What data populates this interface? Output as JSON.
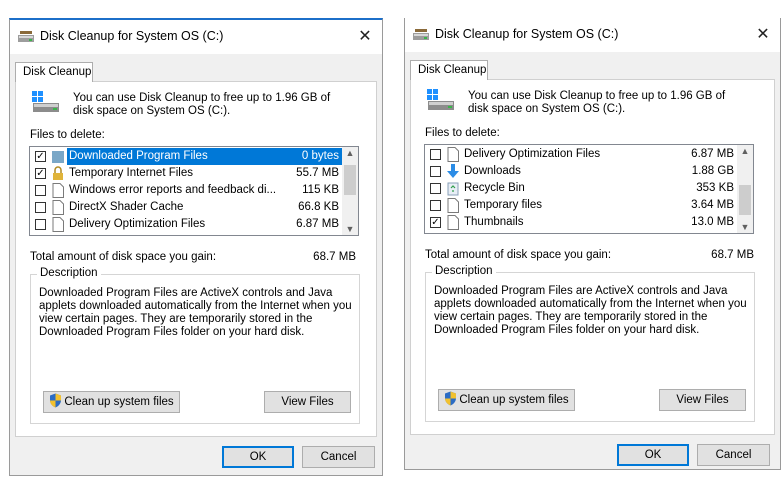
{
  "left": {
    "title": "Disk Cleanup for System OS (C:)",
    "tab": "Disk Cleanup",
    "intro": "You can use Disk Cleanup to free up to 1.96 GB of disk space on System OS (C:).",
    "files_label": "Files to delete:",
    "files": [
      {
        "checked": true,
        "name": "Downloaded Program Files",
        "size": "0 bytes",
        "selected": true,
        "icon": "folder-icon"
      },
      {
        "checked": true,
        "name": "Temporary Internet Files",
        "size": "55.7 MB",
        "selected": false,
        "icon": "lock-icon"
      },
      {
        "checked": false,
        "name": "Windows error reports and feedback di...",
        "size": "115 KB",
        "selected": false,
        "icon": "file-icon"
      },
      {
        "checked": false,
        "name": "DirectX Shader Cache",
        "size": "66.8 KB",
        "selected": false,
        "icon": "file-icon"
      },
      {
        "checked": false,
        "name": "Delivery Optimization Files",
        "size": "6.87 MB",
        "selected": false,
        "icon": "file-icon"
      }
    ],
    "total_label": "Total amount of disk space you gain:",
    "total_value": "68.7 MB",
    "description_legend": "Description",
    "description": "Downloaded Program Files are ActiveX controls and Java applets downloaded automatically from the Internet when you view certain pages. They are temporarily stored in the Downloaded Program Files folder on your hard disk.",
    "cleanup_button": "Clean up system files",
    "view_button": "View Files",
    "ok": "OK",
    "cancel": "Cancel"
  },
  "right": {
    "title": "Disk Cleanup for System OS (C:)",
    "tab": "Disk Cleanup",
    "intro": "You can use Disk Cleanup to free up to 1.96 GB of disk space on System OS (C:).",
    "files_label": "Files to delete:",
    "files": [
      {
        "checked": false,
        "name": "Delivery Optimization Files",
        "size": "6.87 MB",
        "icon": "file-icon"
      },
      {
        "checked": false,
        "name": "Downloads",
        "size": "1.88 GB",
        "icon": "download-arrow-icon"
      },
      {
        "checked": false,
        "name": "Recycle Bin",
        "size": "353 KB",
        "icon": "recycle-bin-icon"
      },
      {
        "checked": false,
        "name": "Temporary files",
        "size": "3.64 MB",
        "icon": "file-icon"
      },
      {
        "checked": true,
        "name": "Thumbnails",
        "size": "13.0 MB",
        "icon": "file-icon"
      }
    ],
    "total_label": "Total amount of disk space you gain:",
    "total_value": "68.7 MB",
    "description_legend": "Description",
    "description": "Downloaded Program Files are ActiveX controls and Java applets downloaded automatically from the Internet when you view certain pages. They are temporarily stored in the Downloaded Program Files folder on your hard disk.",
    "cleanup_button": "Clean up system files",
    "view_button": "View Files",
    "ok": "OK",
    "cancel": "Cancel"
  }
}
